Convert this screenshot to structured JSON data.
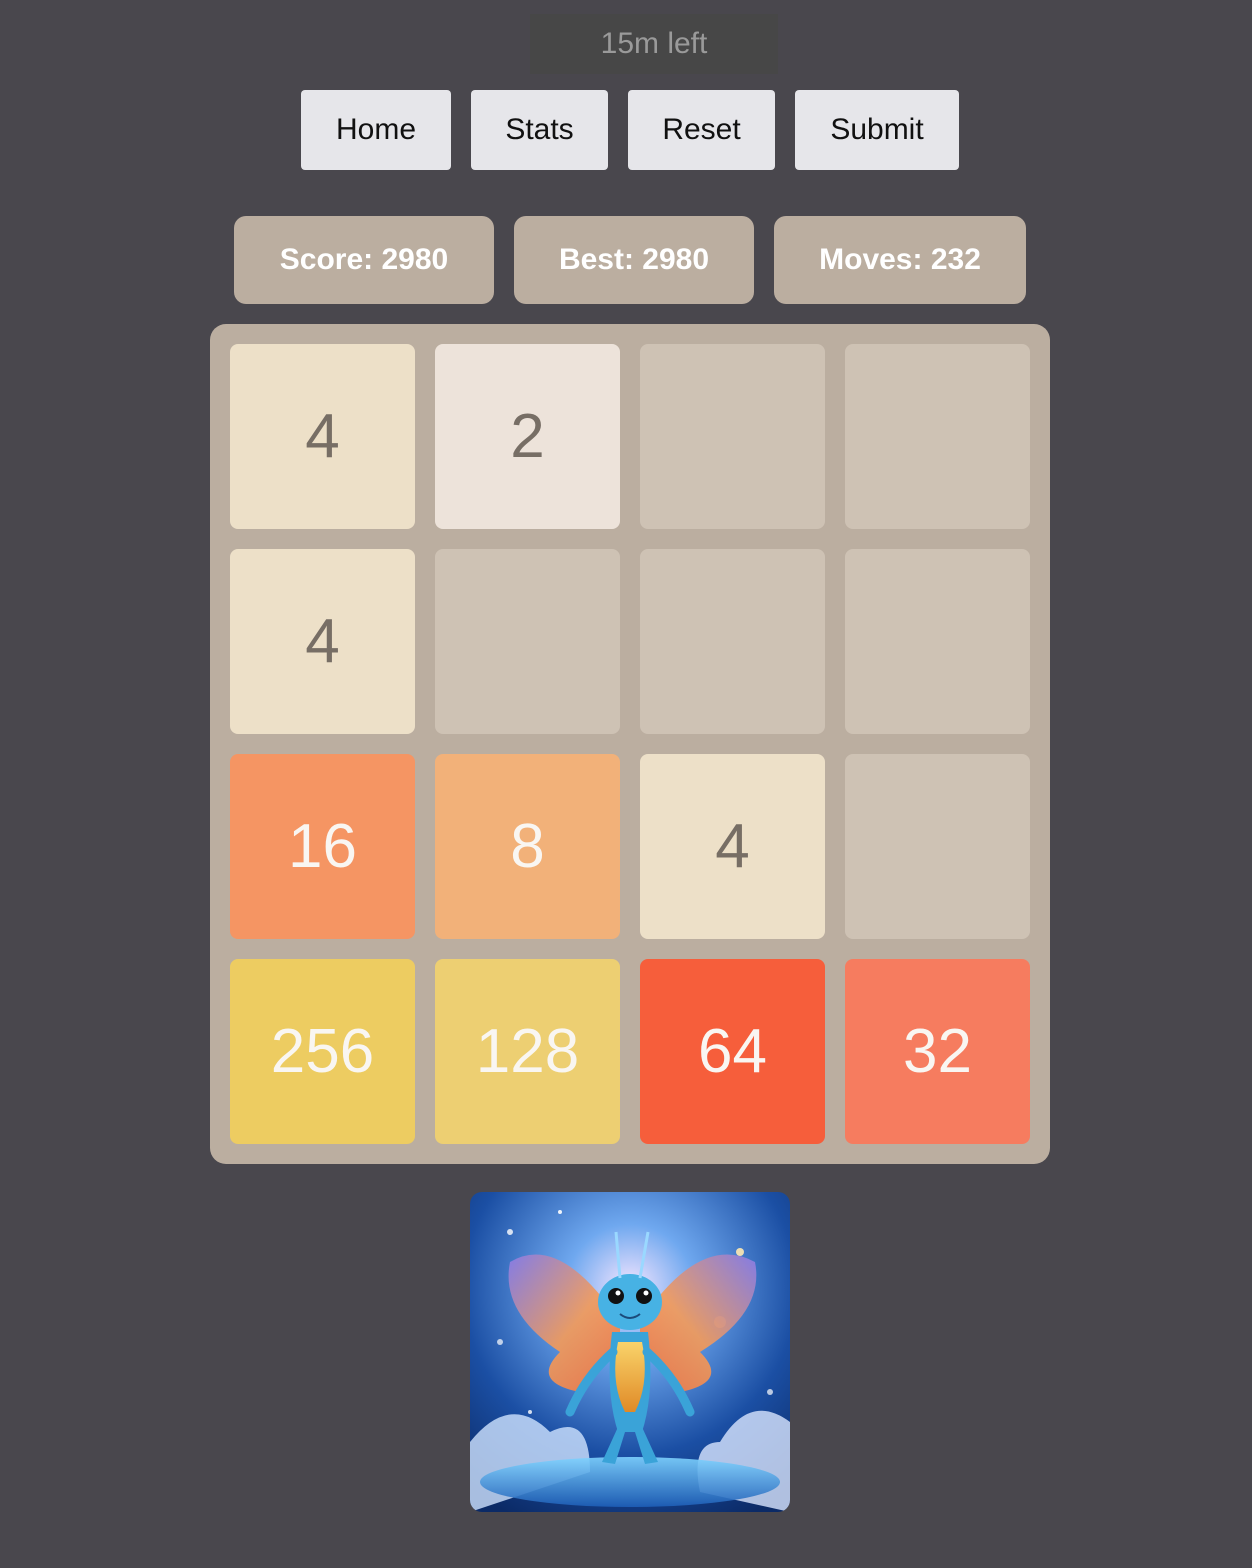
{
  "timer": {
    "text": "15m left"
  },
  "nav": {
    "buttons": [
      {
        "id": "home",
        "label": "Home"
      },
      {
        "id": "stats",
        "label": "Stats"
      },
      {
        "id": "reset",
        "label": "Reset"
      },
      {
        "id": "submit",
        "label": "Submit"
      }
    ]
  },
  "stats": {
    "score_text": "Score: 2980",
    "best_text": "Best: 2980",
    "moves_text": "Moves: 232"
  },
  "board": {
    "size": 4,
    "rows": [
      [
        "4",
        "2",
        "",
        ""
      ],
      [
        "4",
        "",
        "",
        ""
      ],
      [
        "16",
        "8",
        "4",
        ""
      ],
      [
        "256",
        "128",
        "64",
        "32"
      ]
    ]
  },
  "colors": {
    "page_background": "#49474d",
    "board_background": "#bbaea0",
    "empty_cell": "#cec2b4",
    "tile_2": "#ede3da",
    "tile_4": "#ede0c8",
    "tile_8": "#f2b179",
    "tile_16": "#f59563",
    "tile_32": "#f67c5f",
    "tile_64": "#f65e3b",
    "tile_128": "#edcf72",
    "tile_256": "#edcc61",
    "dark_text": "#776e65",
    "light_text": "#f9f6f2"
  },
  "image": {
    "icon": "winged-blue-creature-icon"
  }
}
